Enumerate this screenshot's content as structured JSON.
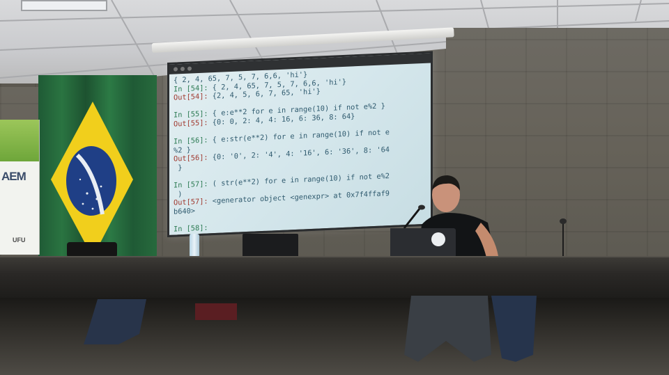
{
  "terminal": {
    "lines": [
      {
        "prompt": "",
        "text": "{ 2, 4, 65, 7, 5, 7, 6,6, 'hi'}"
      },
      {
        "prompt": "In [54]:",
        "text": " { 2, 4, 65, 7, 5, 7, 6,6, 'hi'}"
      },
      {
        "prompt": "Out[54]:",
        "text": " {2, 4, 5, 6, 7, 65, 'hi'}"
      },
      {
        "prompt": "",
        "text": ""
      },
      {
        "prompt": "In [55]:",
        "text": " { e:e**2 for e in range(10) if not e%2 }"
      },
      {
        "prompt": "Out[55]:",
        "text": " {0: 0, 2: 4, 4: 16, 6: 36, 8: 64}"
      },
      {
        "prompt": "",
        "text": ""
      },
      {
        "prompt": "In [56]:",
        "text": " { e:str(e**2) for e in range(10) if not e"
      },
      {
        "prompt": "",
        "text": "%2 }"
      },
      {
        "prompt": "Out[56]:",
        "text": " {0: '0', 2: '4', 4: '16', 6: '36', 8: '64"
      },
      {
        "prompt": "",
        "text": " }"
      },
      {
        "prompt": "",
        "text": ""
      },
      {
        "prompt": "In [57]:",
        "text": " ( str(e**2) for e in range(10) if not e%2"
      },
      {
        "prompt": "",
        "text": " )"
      },
      {
        "prompt": "Out[57]:",
        "text": " <generator object <genexpr> at 0x7f4ffaf9"
      },
      {
        "prompt": "",
        "text": "b640>"
      },
      {
        "prompt": "",
        "text": ""
      },
      {
        "prompt": "In [58]:",
        "text": ""
      }
    ]
  },
  "banner": {
    "logo": "AEM",
    "footer": "UFU"
  },
  "laptop": {
    "sticker": "•"
  },
  "colors": {
    "flag_green": "#2a7441",
    "flag_yellow": "#f1cf1c",
    "flag_blue": "#1f3f86",
    "screen_bg": "#d5e7ec"
  }
}
